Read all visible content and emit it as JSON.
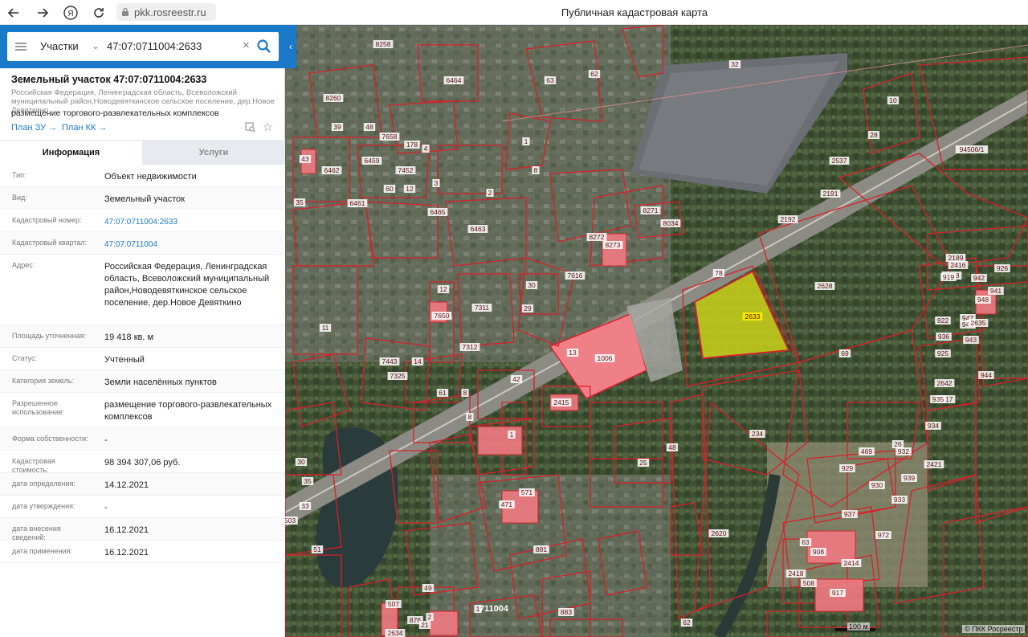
{
  "browser": {
    "url": "pkk.rosreestr.ru",
    "title": "Публичная кадастровая карта"
  },
  "search": {
    "type": "Участки",
    "query": "47:07:0711004:2633"
  },
  "object": {
    "title": "Земельный участок 47:07:0711004:2633",
    "address_short": "Российская Федерация, Ленинградская область, Всеволожский муниципальный район,Новодевяткинское сельское поселение, дер.Новое Девяткино",
    "use": "размещение торгового-развлекательных комплексов",
    "plan_zu": "План ЗУ →",
    "plan_kk": "План КК →"
  },
  "tabs": {
    "info": "Информация",
    "services": "Услуги"
  },
  "properties": [
    {
      "label": "Тип:",
      "value": "Объект недвижимости"
    },
    {
      "label": "Вид:",
      "value": "Земельный участок"
    },
    {
      "label": "Кадастровый номер:",
      "value": "47:07:0711004:2633"
    },
    {
      "label": "Кадастровый квартал:",
      "value": "47:07:0711004"
    },
    {
      "label": "Адрес:",
      "value": "Российская Федерация, Ленинградская область, Всеволожский муниципальный район,Новодевяткинское сельское поселение, дер.Новое Девяткино"
    },
    {
      "label": "Площадь уточненная:",
      "value": "19 418 кв. м"
    },
    {
      "label": "Статус:",
      "value": "Учтенный"
    },
    {
      "label": "Категория земель:",
      "value": "Земли населённых пунктов"
    },
    {
      "label": "Разрешенное использование:",
      "value": "размещение торгового-развлекательных комплексов"
    },
    {
      "label": "Форма собственности:",
      "value": "-"
    },
    {
      "label": "Кадастровая стоимость:",
      "value": "98 394 307,06 руб."
    },
    {
      "label": "дата определения:",
      "value": "14.12.2021"
    },
    {
      "label": "дата утверждения:",
      "value": "-"
    },
    {
      "label": "дата внесения сведений:",
      "value": "16.12.2021"
    },
    {
      "label": "дата применения:",
      "value": "16.12.2021"
    }
  ],
  "map": {
    "parcel_labels": [
      "8258",
      "6464",
      "63",
      "62",
      "32",
      "8260",
      "39",
      "48",
      "7658",
      "178",
      "4",
      "43",
      "6462",
      "6459",
      "7452",
      "60",
      "12",
      "3",
      "2",
      "6461",
      "6465",
      "35",
      "6463",
      "8",
      "1",
      "10",
      "28",
      "94506/1",
      "2191",
      "2192",
      "2537",
      "8271",
      "8034",
      "8272",
      "8273",
      "7616",
      "78",
      "2628",
      "2633",
      "69",
      "7311",
      "29",
      "30",
      "12",
      "7650",
      "11",
      "7312",
      "13",
      "1006",
      "14",
      "7325",
      "7443",
      "42",
      "61",
      "8",
      "8",
      "2415",
      "1",
      "234",
      "48",
      "25",
      "26",
      "469",
      "929",
      "930",
      "932",
      "939",
      "933",
      "934",
      "937",
      "2620",
      "62",
      "63",
      "908",
      "2414",
      "2418",
      "508",
      "917",
      "972",
      "2421",
      "2417",
      "2416",
      "2189",
      "2188",
      "919",
      "942",
      "948",
      "947",
      "946",
      "943",
      "944",
      "2635",
      "2642",
      "935",
      "925",
      "922",
      "936",
      "941",
      "926",
      "571",
      "471",
      "881",
      "49",
      "507",
      "2634",
      "876",
      "711004",
      "883",
      "1",
      "2",
      "21",
      "30",
      "35",
      "33",
      "503",
      "51"
    ],
    "selected_label": "2633",
    "district_label": "711004",
    "scale": "100 м",
    "copyright": "© ПКК Росреестр",
    "colors": {
      "boundary": "#d8202a",
      "building_fill": "#f07a82",
      "selected_fill": "#c9d21a"
    }
  }
}
